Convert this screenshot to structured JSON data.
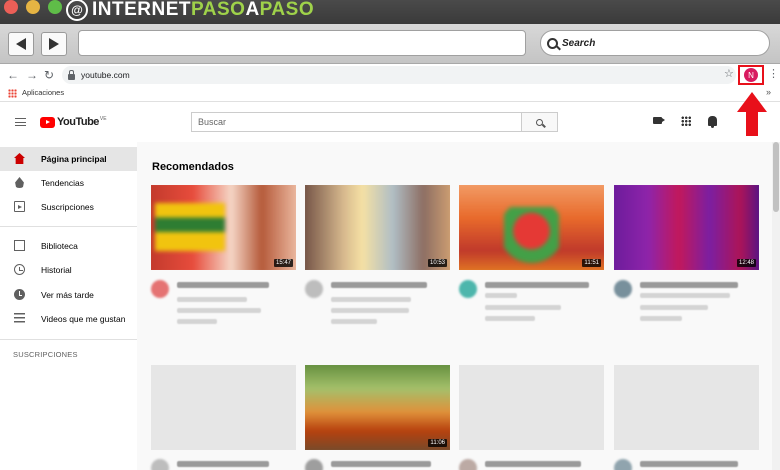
{
  "brand": {
    "part1": "INTERNET",
    "part2": "PASO",
    "part3": "A",
    "part4": "PASO"
  },
  "mac_toolbar": {
    "search_label": "Search"
  },
  "chrome": {
    "url": "youtube.com",
    "avatar_initial": "N",
    "bookmarks_apps": "Aplicaciones",
    "more": "»"
  },
  "youtube": {
    "logo_text": "YouTube",
    "country": "VE",
    "search_placeholder": "Buscar",
    "sidebar": {
      "items": [
        {
          "label": "Página principal"
        },
        {
          "label": "Tendencias"
        },
        {
          "label": "Suscripciones"
        },
        {
          "label": "Biblioteca"
        },
        {
          "label": "Historial"
        },
        {
          "label": "Ver más tarde"
        },
        {
          "label": "Videos que me gustan"
        }
      ],
      "subscriptions_heading": "SUSCRIPCIONES"
    },
    "section_title": "Recomendados",
    "videos_row1": [
      {
        "duration": "15:47"
      },
      {
        "duration": "10:53"
      },
      {
        "duration": "11:51"
      },
      {
        "duration": "12:48"
      }
    ],
    "videos_row2": [
      {
        "duration": ""
      },
      {
        "duration": "11:06"
      },
      {
        "duration": ""
      },
      {
        "duration": ""
      }
    ]
  },
  "colors": {
    "highlight_red": "#e8101a",
    "youtube_red": "#ff0000",
    "brand_green": "#9fd24a"
  }
}
